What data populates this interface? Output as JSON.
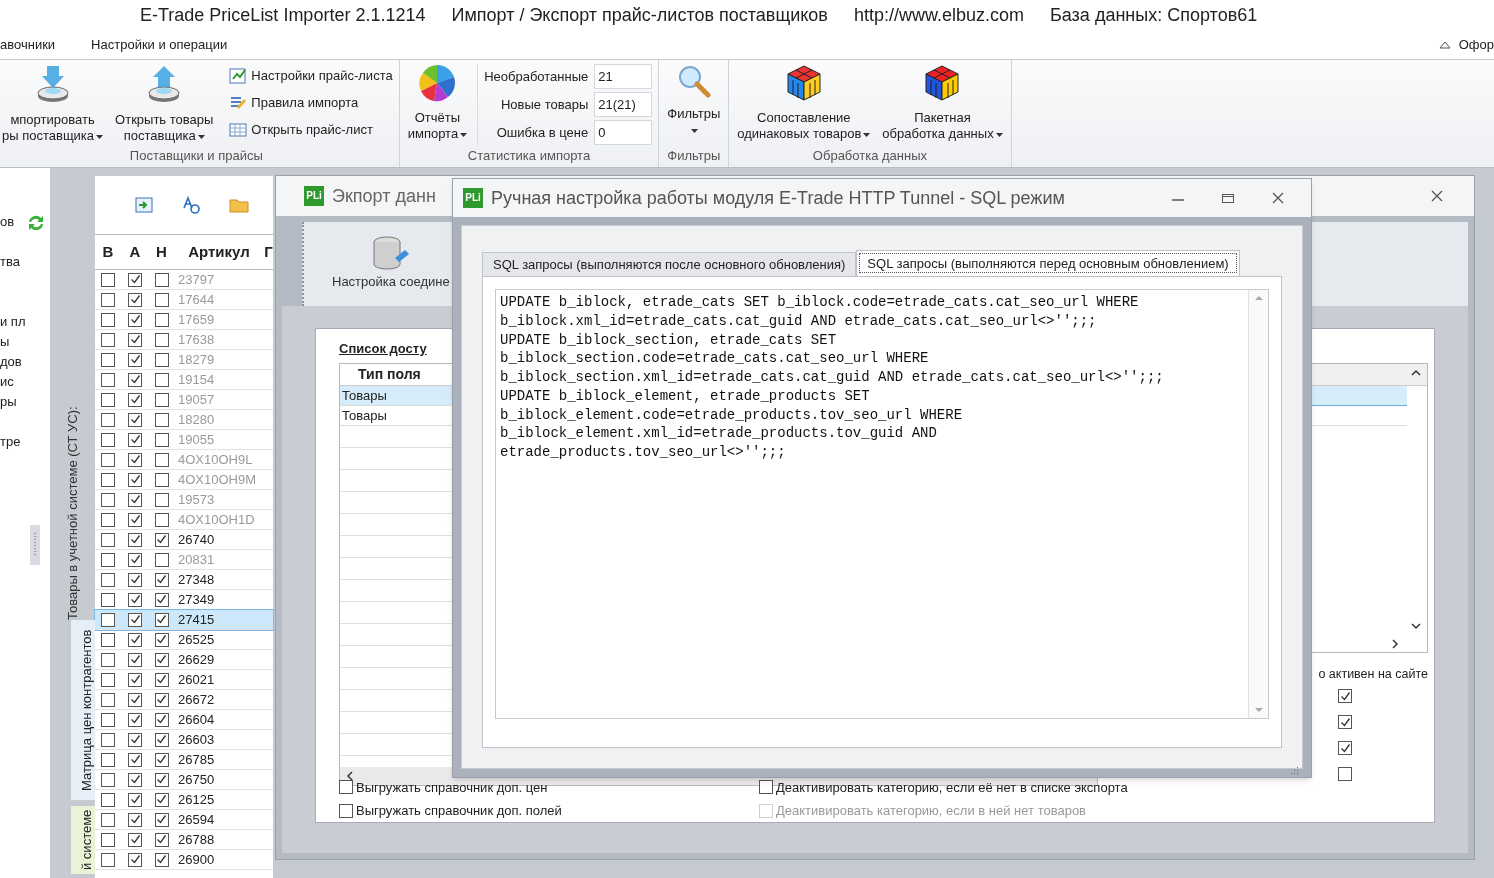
{
  "title_bar": {
    "segments": [
      "E-Trade PriceList Importer 2.1.1214",
      "Импорт / Экспорт прайс-листов поставщиков",
      "http://www.elbuz.com",
      "База данных: Спортов61"
    ]
  },
  "menu": {
    "items": [
      {
        "label": "авочники"
      },
      {
        "label": "Настройки и операции"
      }
    ],
    "right_label": "Офор"
  },
  "ribbon": {
    "groups": [
      {
        "label": "Поставщики и прайсы",
        "items": [
          {
            "kind": "large",
            "lines": [
              "мпортировать",
              "ры поставщика"
            ],
            "dropdown": true
          },
          {
            "kind": "large",
            "lines": [
              "Открыть товары",
              "поставщика"
            ],
            "dropdown": true
          },
          {
            "kind": "small_list",
            "entries": [
              "Настройки прайс-листа",
              "Правила импорта",
              "Открыть прайс-лист"
            ]
          }
        ]
      },
      {
        "label": "Статистика импорта",
        "items": [
          {
            "kind": "large",
            "lines": [
              "Отчёты",
              "импорта"
            ],
            "dropdown": true
          },
          {
            "kind": "stats",
            "rows": [
              {
                "label": "Необработанные",
                "value": "21"
              },
              {
                "label": "Новые товары",
                "value": "21(21)"
              },
              {
                "label": "Ошибка в цене",
                "value": "0"
              }
            ]
          }
        ]
      },
      {
        "label": "Фильтры",
        "items": [
          {
            "kind": "large",
            "lines": [
              "Фильтры"
            ],
            "dropdown": true
          }
        ]
      },
      {
        "label": "Обработка данных",
        "items": [
          {
            "kind": "large",
            "lines": [
              "Сопоставление",
              "одинаковых товаров"
            ],
            "dropdown": true
          },
          {
            "kind": "large",
            "lines": [
              "Пакетная",
              "обработка данных"
            ],
            "dropdown": true
          }
        ]
      }
    ]
  },
  "left_strip": {
    "fragments": [
      "ов",
      "тва",
      "и пл",
      "ы",
      "дов",
      "ис",
      "ры",
      "тре"
    ]
  },
  "side_tabs": {
    "caption": "Товары в учетной системе (СТ УС):",
    "tabs": [
      {
        "label": "Матрица цен контрагентов",
        "selected": false
      },
      {
        "label": "й системе",
        "selected": true
      }
    ]
  },
  "products_table": {
    "columns": [
      "В",
      "А",
      "Н",
      "Артикул",
      "Г"
    ],
    "rows": [
      {
        "b": false,
        "a": true,
        "n": false,
        "article": "23797",
        "selected": false
      },
      {
        "b": false,
        "a": true,
        "n": false,
        "article": "17644",
        "selected": false
      },
      {
        "b": false,
        "a": true,
        "n": false,
        "article": "17659",
        "selected": false
      },
      {
        "b": false,
        "a": true,
        "n": false,
        "article": "17638",
        "selected": false
      },
      {
        "b": false,
        "a": true,
        "n": false,
        "article": "18279",
        "selected": false
      },
      {
        "b": false,
        "a": true,
        "n": false,
        "article": "19154",
        "selected": false
      },
      {
        "b": false,
        "a": true,
        "n": false,
        "article": "19057",
        "selected": false
      },
      {
        "b": false,
        "a": true,
        "n": false,
        "article": "18280",
        "selected": false
      },
      {
        "b": false,
        "a": true,
        "n": false,
        "article": "19055",
        "selected": false
      },
      {
        "b": false,
        "a": true,
        "n": false,
        "article": "4OX10OH9L",
        "selected": false
      },
      {
        "b": false,
        "a": true,
        "n": false,
        "article": "4OX10OH9M",
        "selected": false
      },
      {
        "b": false,
        "a": true,
        "n": false,
        "article": "19573",
        "selected": false
      },
      {
        "b": false,
        "a": true,
        "n": false,
        "article": "4OX10OH1D",
        "selected": false
      },
      {
        "b": false,
        "a": true,
        "n": true,
        "article": "26740",
        "selected": false
      },
      {
        "b": false,
        "a": true,
        "n": false,
        "article": "20831",
        "selected": false
      },
      {
        "b": false,
        "a": true,
        "n": true,
        "article": "27348",
        "selected": false
      },
      {
        "b": false,
        "a": true,
        "n": true,
        "article": "27349",
        "selected": false
      },
      {
        "b": false,
        "a": true,
        "n": true,
        "article": "27415",
        "selected": true
      },
      {
        "b": false,
        "a": true,
        "n": true,
        "article": "26525",
        "selected": false
      },
      {
        "b": false,
        "a": true,
        "n": true,
        "article": "26629",
        "selected": false
      },
      {
        "b": false,
        "a": true,
        "n": true,
        "article": "26021",
        "selected": false
      },
      {
        "b": false,
        "a": true,
        "n": true,
        "article": "26672",
        "selected": false
      },
      {
        "b": false,
        "a": true,
        "n": true,
        "article": "26604",
        "selected": false
      },
      {
        "b": false,
        "a": true,
        "n": true,
        "article": "26603",
        "selected": false
      },
      {
        "b": false,
        "a": true,
        "n": true,
        "article": "26785",
        "selected": false
      },
      {
        "b": false,
        "a": true,
        "n": true,
        "article": "26750",
        "selected": false
      },
      {
        "b": false,
        "a": true,
        "n": true,
        "article": "26125",
        "selected": false
      },
      {
        "b": false,
        "a": true,
        "n": true,
        "article": "26594",
        "selected": false
      },
      {
        "b": false,
        "a": true,
        "n": true,
        "article": "26788",
        "selected": false
      },
      {
        "b": false,
        "a": true,
        "n": true,
        "article": "26900",
        "selected": false
      }
    ]
  },
  "export_window": {
    "logo": "PLi",
    "title": "Экпорт данн",
    "toolbar_button": "Настройка соедине",
    "section_title": "Список досту",
    "fields_table": {
      "column": "Тип поля",
      "rows": [
        {
          "label": "Товары",
          "selected": true
        },
        {
          "label": "Товары",
          "selected": false
        }
      ]
    },
    "active_column": {
      "label": "о активен на сайте",
      "checks": [
        true,
        true,
        true,
        false
      ]
    },
    "options": [
      {
        "label": "Выгружать справочник доп. цен",
        "checked": false,
        "disabled": false
      },
      {
        "label": "Выгружать справочник доп. полей",
        "checked": false,
        "disabled": false
      },
      {
        "label": "Деактивировать категорию, если её нет в списке экспорта",
        "checked": false,
        "disabled": false
      },
      {
        "label": "Деактивировать категорию, если в ней нет товаров",
        "checked": false,
        "disabled": true
      }
    ]
  },
  "sql_dialog": {
    "logo": "PLi",
    "title": "Ручная настройка работы модуля E-Trade HTTP Tunnel - SQL режим",
    "tabs": [
      {
        "label": "SQL запросы (выполняются после основного обновления)",
        "selected": false
      },
      {
        "label": "SQL запросы (выполняются перед основным обновлением)",
        "selected": true
      }
    ],
    "value": "UPDATE b_iblock, etrade_cats SET b_iblock.code=etrade_cats.cat_seo_url WHERE\nb_iblock.xml_id=etrade_cats.cat_guid AND etrade_cats.cat_seo_url<>'';;;\nUPDATE b_iblock_section, etrade_cats SET\nb_iblock_section.code=etrade_cats.cat_seo_url WHERE\nb_iblock_section.xml_id=etrade_cats.cat_guid AND etrade_cats.cat_seo_url<>'';;;\nUPDATE b_iblock_element, etrade_products SET\nb_iblock_element.code=etrade_products.tov_seo_url WHERE\nb_iblock_element.xml_id=etrade_products.tov_guid AND\netrade_products.tov_seo_url<>'';;;"
  }
}
